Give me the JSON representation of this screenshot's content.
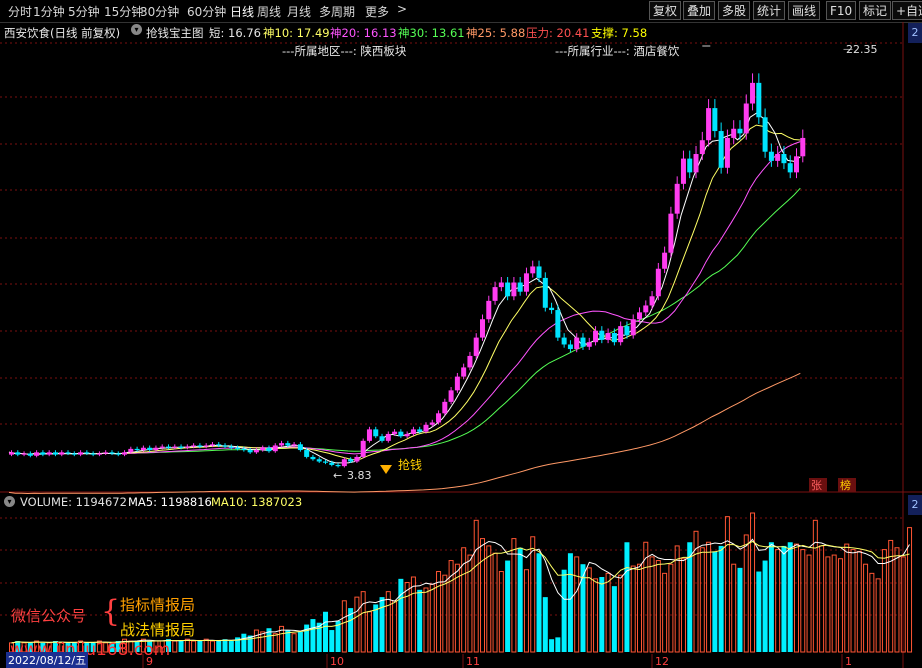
{
  "toolbar": {
    "periods": [
      "分时",
      "1分钟",
      "5分钟",
      "15分钟",
      "30分钟",
      "60分钟",
      "日线",
      "周线",
      "月线",
      "多周期",
      "更多"
    ],
    "more_arrow": ">",
    "active_period": "日线",
    "right_buttons": [
      "复权",
      "叠加",
      "多股",
      "统计",
      "画线",
      "F10",
      "标记",
      "+自选"
    ]
  },
  "header": {
    "stock": "西安饮食(日线 前复权)",
    "indicator_name": "抢钱宝主图",
    "items": [
      {
        "label": "短: 16.76",
        "color": "#e6e6e6"
      },
      {
        "label": "神10: 17.49",
        "color": "#ffff66"
      },
      {
        "label": "神20: 16.13",
        "color": "#ff55ff"
      },
      {
        "label": "神30: 13.61",
        "color": "#55ff55"
      },
      {
        "label": "神25: 5.88",
        "color": "#ff9966"
      },
      {
        "label": "压力: 20.41",
        "color": "#ff5050"
      },
      {
        "label": "支撑: 7.58",
        "color": "#ffff00"
      }
    ]
  },
  "subheader": {
    "region": "---所属地区---: 陕西板块",
    "industry": "---所属行业---: 酒店餐饮"
  },
  "annotations": {
    "high_label": "22.35",
    "low_label": "3.83",
    "low_arrow": "←",
    "signal_label": "抢钱",
    "zhang": "张",
    "bang": "榜"
  },
  "volume_header": {
    "title": "VOLUME: 1194672",
    "ma5": "MA5: 1198816",
    "ma10": "MA10: 1387023",
    "colors": {
      "title": "#e0e0e0",
      "ma5": "#ffffff",
      "ma10": "#ffff66"
    }
  },
  "watermark": {
    "left": "微信公众号",
    "brace": "{",
    "line1": "指标情报局",
    "line2": "战法情报局",
    "url": "www.jinjiu168.com"
  },
  "time_axis": {
    "start_date": "2022/08/12/五",
    "month_labels": [
      "9",
      "10",
      "11",
      "12",
      "1"
    ]
  },
  "right_tabs": [
    "2",
    "2"
  ],
  "colors": {
    "up": "#ff3df0",
    "down": "#00e4ff",
    "vol_up": "#ff5533",
    "vol_down": "#00f0ff",
    "ma_short": "#ffffff",
    "ma10": "#ffff66",
    "ma20": "#ff55ff",
    "ma30": "#55ff55",
    "ma25": "#ff9966",
    "grid": "#7a1111"
  },
  "chart_data": {
    "type": "candlestick",
    "high": 22.35,
    "low": 3.83,
    "candles": [
      {
        "o": 4.5,
        "c": 4.6
      },
      {
        "o": 4.6,
        "c": 4.5
      },
      {
        "o": 4.5,
        "c": 4.55
      },
      {
        "o": 4.55,
        "c": 4.45
      },
      {
        "o": 4.45,
        "c": 4.6
      },
      {
        "o": 4.6,
        "c": 4.5
      },
      {
        "o": 4.5,
        "c": 4.6
      },
      {
        "o": 4.6,
        "c": 4.5
      },
      {
        "o": 4.5,
        "c": 4.6
      },
      {
        "o": 4.6,
        "c": 4.55
      },
      {
        "o": 4.55,
        "c": 4.5
      },
      {
        "o": 4.5,
        "c": 4.6
      },
      {
        "o": 4.6,
        "c": 4.55
      },
      {
        "o": 4.55,
        "c": 4.5
      },
      {
        "o": 4.5,
        "c": 4.55
      },
      {
        "o": 4.55,
        "c": 4.6
      },
      {
        "o": 4.6,
        "c": 4.55
      },
      {
        "o": 4.55,
        "c": 4.5
      },
      {
        "o": 4.5,
        "c": 4.6
      },
      {
        "o": 4.6,
        "c": 4.75
      },
      {
        "o": 4.75,
        "c": 4.7
      },
      {
        "o": 4.7,
        "c": 4.8
      },
      {
        "o": 4.8,
        "c": 4.7
      },
      {
        "o": 4.7,
        "c": 4.8
      },
      {
        "o": 4.8,
        "c": 4.85
      },
      {
        "o": 4.85,
        "c": 4.8
      },
      {
        "o": 4.8,
        "c": 4.85
      },
      {
        "o": 4.85,
        "c": 4.8
      },
      {
        "o": 4.8,
        "c": 4.85
      },
      {
        "o": 4.85,
        "c": 4.9
      },
      {
        "o": 4.9,
        "c": 4.85
      },
      {
        "o": 4.85,
        "c": 4.9
      },
      {
        "o": 4.9,
        "c": 4.95
      },
      {
        "o": 4.95,
        "c": 4.9
      },
      {
        "o": 4.9,
        "c": 4.85
      },
      {
        "o": 4.85,
        "c": 4.8
      },
      {
        "o": 4.8,
        "c": 4.75
      },
      {
        "o": 4.75,
        "c": 4.7
      },
      {
        "o": 4.7,
        "c": 4.6
      },
      {
        "o": 4.6,
        "c": 4.7
      },
      {
        "o": 4.7,
        "c": 4.8
      },
      {
        "o": 4.8,
        "c": 4.65
      },
      {
        "o": 4.65,
        "c": 4.9
      },
      {
        "o": 4.9,
        "c": 5.0
      },
      {
        "o": 5.0,
        "c": 4.9
      },
      {
        "o": 4.9,
        "c": 4.95
      },
      {
        "o": 4.95,
        "c": 4.7
      },
      {
        "o": 4.7,
        "c": 4.4
      },
      {
        "o": 4.4,
        "c": 4.3
      },
      {
        "o": 4.3,
        "c": 4.2
      },
      {
        "o": 4.2,
        "c": 4.15
      },
      {
        "o": 4.15,
        "c": 4.05
      },
      {
        "o": 4.05,
        "c": 4.0
      },
      {
        "o": 4.0,
        "c": 4.3
      },
      {
        "o": 4.3,
        "c": 4.2
      },
      {
        "o": 4.2,
        "c": 4.4
      },
      {
        "o": 4.4,
        "c": 5.1
      },
      {
        "o": 5.1,
        "c": 5.6
      },
      {
        "o": 5.6,
        "c": 5.3
      },
      {
        "o": 5.3,
        "c": 5.1
      },
      {
        "o": 5.1,
        "c": 5.4
      },
      {
        "o": 5.4,
        "c": 5.5
      },
      {
        "o": 5.5,
        "c": 5.3
      },
      {
        "o": 5.3,
        "c": 5.4
      },
      {
        "o": 5.4,
        "c": 5.6
      },
      {
        "o": 5.6,
        "c": 5.5
      },
      {
        "o": 5.5,
        "c": 5.8
      },
      {
        "o": 5.8,
        "c": 5.9
      },
      {
        "o": 5.9,
        "c": 6.3
      },
      {
        "o": 6.3,
        "c": 6.8
      },
      {
        "o": 6.8,
        "c": 7.3
      },
      {
        "o": 7.3,
        "c": 7.9
      },
      {
        "o": 7.9,
        "c": 8.3
      },
      {
        "o": 8.3,
        "c": 8.8
      },
      {
        "o": 8.8,
        "c": 9.6
      },
      {
        "o": 9.6,
        "c": 10.4
      },
      {
        "o": 10.4,
        "c": 11.2
      },
      {
        "o": 11.2,
        "c": 11.8
      },
      {
        "o": 11.8,
        "c": 12.0
      },
      {
        "o": 12.0,
        "c": 11.4
      },
      {
        "o": 11.4,
        "c": 12.0
      },
      {
        "o": 12.0,
        "c": 11.6
      },
      {
        "o": 11.6,
        "c": 12.4
      },
      {
        "o": 12.4,
        "c": 12.7
      },
      {
        "o": 12.7,
        "c": 12.2
      },
      {
        "o": 12.2,
        "c": 10.9
      },
      {
        "o": 10.9,
        "c": 10.8
      },
      {
        "o": 10.8,
        "c": 9.6
      },
      {
        "o": 9.6,
        "c": 9.3
      },
      {
        "o": 9.3,
        "c": 9.1
      },
      {
        "o": 9.1,
        "c": 9.6
      },
      {
        "o": 9.6,
        "c": 9.2
      },
      {
        "o": 9.2,
        "c": 9.4
      },
      {
        "o": 9.4,
        "c": 9.9
      },
      {
        "o": 9.9,
        "c": 9.5
      },
      {
        "o": 9.5,
        "c": 9.8
      },
      {
        "o": 9.8,
        "c": 9.4
      },
      {
        "o": 9.4,
        "c": 10.1
      },
      {
        "o": 10.1,
        "c": 9.7
      },
      {
        "o": 9.7,
        "c": 10.4
      },
      {
        "o": 10.4,
        "c": 10.7
      },
      {
        "o": 10.7,
        "c": 11.0
      },
      {
        "o": 11.0,
        "c": 11.4
      },
      {
        "o": 11.4,
        "c": 12.6
      },
      {
        "o": 12.6,
        "c": 13.3
      },
      {
        "o": 13.3,
        "c": 15.0
      },
      {
        "o": 15.0,
        "c": 16.3
      },
      {
        "o": 16.3,
        "c": 17.4
      },
      {
        "o": 17.4,
        "c": 16.8
      },
      {
        "o": 16.8,
        "c": 17.6
      },
      {
        "o": 17.6,
        "c": 18.2
      },
      {
        "o": 18.2,
        "c": 19.6
      },
      {
        "o": 19.6,
        "c": 18.6
      },
      {
        "o": 18.6,
        "c": 17.0
      },
      {
        "o": 17.0,
        "c": 18.3
      },
      {
        "o": 18.3,
        "c": 18.7
      },
      {
        "o": 18.7,
        "c": 18.5
      },
      {
        "o": 18.5,
        "c": 19.8
      },
      {
        "o": 19.8,
        "c": 20.7
      },
      {
        "o": 20.7,
        "c": 19.2
      },
      {
        "o": 19.2,
        "c": 17.7
      },
      {
        "o": 17.7,
        "c": 17.3
      },
      {
        "o": 17.3,
        "c": 17.6
      },
      {
        "o": 17.6,
        "c": 17.2
      },
      {
        "o": 17.2,
        "c": 16.8
      },
      {
        "o": 16.8,
        "c": 17.5
      },
      {
        "o": 17.5,
        "c": 18.3
      }
    ],
    "volume": [
      5,
      6,
      5,
      5,
      6,
      5,
      5,
      6,
      5,
      5,
      5,
      6,
      5,
      5,
      6,
      5,
      5,
      6,
      7,
      6,
      6,
      7,
      6,
      6,
      6,
      7,
      6,
      6,
      7,
      6,
      6,
      7,
      6,
      6,
      7,
      6,
      8,
      10,
      9,
      12,
      11,
      13,
      10,
      14,
      12,
      10,
      11,
      15,
      18,
      16,
      22,
      12,
      17,
      28,
      24,
      30,
      33,
      22,
      26,
      30,
      33,
      28,
      40,
      38,
      41,
      34,
      35,
      37,
      44,
      42,
      50,
      48,
      57,
      53,
      72,
      62,
      58,
      54,
      44,
      50,
      62,
      57,
      45,
      63,
      54,
      30,
      7,
      8,
      45,
      54,
      52,
      48,
      46,
      40,
      41,
      43,
      36,
      42,
      60,
      47,
      48,
      60,
      52,
      50,
      43,
      48,
      58,
      51,
      60,
      66,
      57,
      60,
      55,
      58,
      74,
      48,
      46,
      64,
      76,
      44,
      50,
      60,
      56,
      58,
      60,
      59,
      56,
      53,
      72,
      58,
      52,
      53,
      51,
      59,
      56,
      55,
      48,
      43,
      40,
      56,
      61,
      57,
      52,
      68
    ]
  }
}
